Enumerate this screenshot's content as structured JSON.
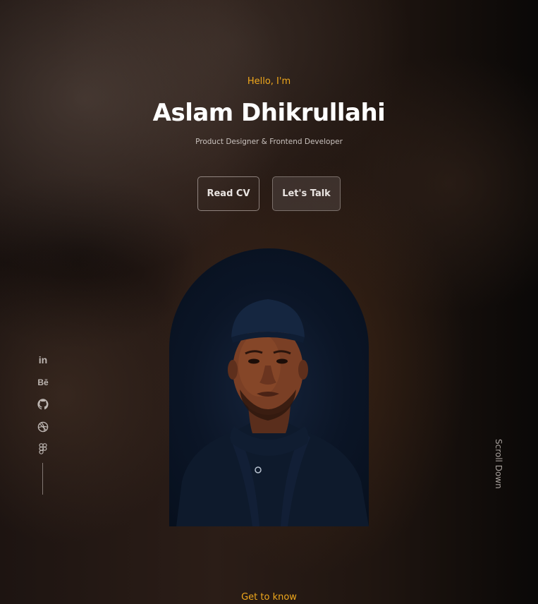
{
  "hero": {
    "greeting": "Hello, I'm",
    "name": "Aslam Dhikrullahi",
    "role": "Product Designer & Frontend Developer"
  },
  "buttons": {
    "read_cv": "Read CV",
    "lets_talk": "Let's Talk"
  },
  "social": {
    "linkedin": "in",
    "behance": "Bē",
    "icons": [
      "linkedin-icon",
      "behance-icon",
      "github-icon",
      "dribbble-icon",
      "figma-icon"
    ]
  },
  "scroll": {
    "label": "Scroll Down"
  },
  "footer": {
    "next_section": "Get to know"
  },
  "colors": {
    "accent": "#f0a81c",
    "text": "#ffffff",
    "muted": "#c9c2be"
  }
}
